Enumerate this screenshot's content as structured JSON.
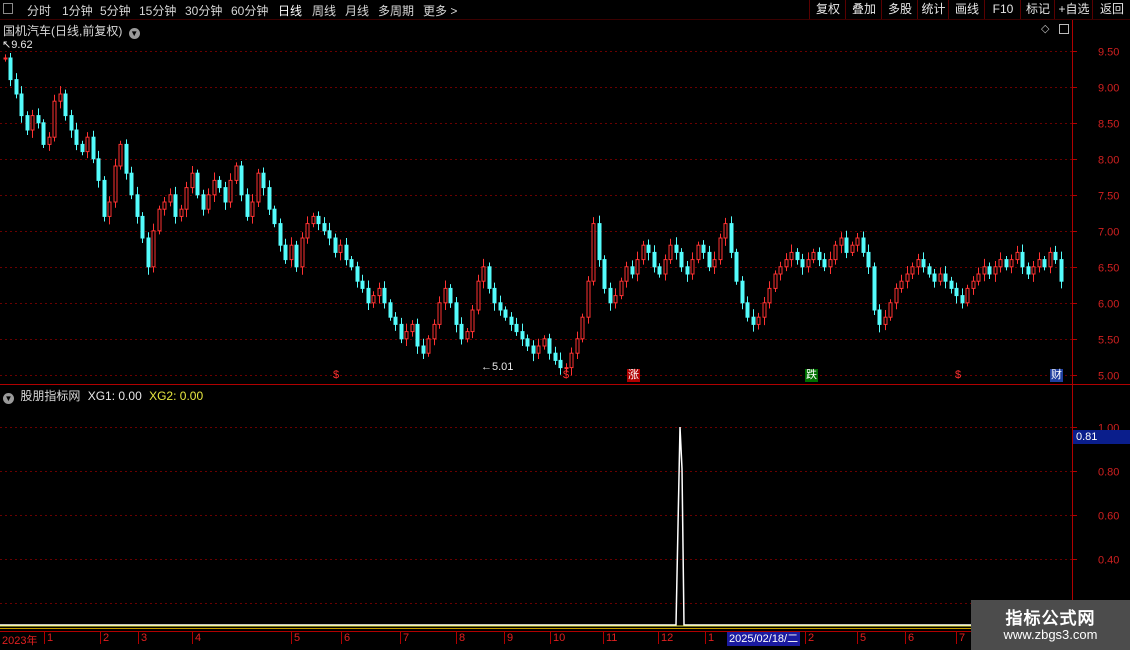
{
  "toolbar": {
    "periods": [
      "分时",
      "1分钟",
      "5分钟",
      "15分钟",
      "30分钟",
      "60分钟",
      "日线",
      "周线",
      "月线",
      "多周期",
      "更多 >"
    ],
    "active_period": "日线",
    "buttons": [
      "复权",
      "叠加",
      "多股",
      "统计",
      "画线",
      "F10",
      "标记",
      "+自选",
      "返回"
    ]
  },
  "main_chart": {
    "stock_title": "国机汽车(日线,前复权)",
    "high_label": "9.62",
    "low_label": "5.01",
    "markers": [
      {
        "text": "$",
        "color": "#ff3030"
      },
      {
        "text": "$",
        "color": "#ff3030"
      },
      {
        "text": "涨",
        "color": "#ffffff",
        "bg": "#b00000"
      },
      {
        "text": "跌",
        "color": "#ffffff",
        "bg": "#007000"
      },
      {
        "text": "$",
        "color": "#ff3030"
      },
      {
        "text": "财",
        "color": "#ffffff",
        "bg": "#2040a0"
      }
    ]
  },
  "indicator": {
    "name": "股朋指标网",
    "xg1": "XG1: 0.00",
    "xg2": "XG2: 0.00",
    "current_value": "0.81"
  },
  "time_axis": {
    "year_label": "2023年",
    "months": [
      "1",
      "2",
      "3",
      "4",
      "5",
      "6",
      "7",
      "8",
      "9",
      "10",
      "11",
      "12",
      "1",
      "2",
      "4",
      "5",
      "6",
      "7"
    ],
    "cursor_date": "2025/02/18/二"
  },
  "watermark": {
    "title": "指标公式网",
    "url": "www.zbgs3.com"
  },
  "chart_data": [
    {
      "type": "candlestick",
      "title": "国机汽车(日线,前复权)",
      "ylim": [
        4.9,
        9.9
      ],
      "y_ticks": [
        5.0,
        5.5,
        6.0,
        6.5,
        7.0,
        7.5,
        8.0,
        8.5,
        9.0,
        9.5
      ],
      "annotations": [
        {
          "label": "9.62",
          "kind": "high"
        },
        {
          "label": "5.01",
          "kind": "low"
        }
      ],
      "close_series": [
        9.4,
        9.1,
        8.9,
        8.6,
        8.4,
        8.6,
        8.5,
        8.2,
        8.3,
        8.8,
        8.9,
        8.6,
        8.4,
        8.2,
        8.1,
        8.3,
        8.0,
        7.7,
        7.2,
        7.4,
        7.9,
        8.2,
        7.8,
        7.5,
        7.2,
        6.9,
        6.5,
        7.0,
        7.3,
        7.4,
        7.5,
        7.2,
        7.3,
        7.6,
        7.8,
        7.5,
        7.3,
        7.5,
        7.7,
        7.6,
        7.4,
        7.7,
        7.9,
        7.5,
        7.2,
        7.4,
        7.8,
        7.6,
        7.3,
        7.1,
        6.8,
        6.6,
        6.8,
        6.5,
        6.9,
        7.1,
        7.2,
        7.1,
        7.0,
        6.9,
        6.7,
        6.8,
        6.6,
        6.5,
        6.3,
        6.2,
        6.0,
        6.1,
        6.2,
        6.0,
        5.8,
        5.7,
        5.5,
        5.6,
        5.7,
        5.4,
        5.3,
        5.5,
        5.7,
        6.0,
        6.2,
        6.0,
        5.7,
        5.5,
        5.6,
        5.9,
        6.3,
        6.5,
        6.2,
        6.0,
        5.9,
        5.8,
        5.7,
        5.6,
        5.5,
        5.4,
        5.3,
        5.4,
        5.5,
        5.3,
        5.2,
        5.1,
        5.1,
        5.3,
        5.5,
        5.8,
        6.3,
        7.1,
        6.6,
        6.2,
        6.0,
        6.1,
        6.3,
        6.5,
        6.4,
        6.6,
        6.8,
        6.7,
        6.5,
        6.4,
        6.6,
        6.8,
        6.7,
        6.5,
        6.4,
        6.6,
        6.8,
        6.7,
        6.5,
        6.6,
        6.9,
        7.1,
        6.7,
        6.3,
        6.0,
        5.8,
        5.7,
        5.8,
        6.0,
        6.2,
        6.4,
        6.5,
        6.6,
        6.7,
        6.6,
        6.5,
        6.6,
        6.7,
        6.6,
        6.5,
        6.6,
        6.8,
        6.9,
        6.7,
        6.8,
        6.9,
        6.7,
        6.5,
        5.9,
        5.7,
        5.8,
        6.0,
        6.2,
        6.3,
        6.4,
        6.5,
        6.6,
        6.5,
        6.4,
        6.3,
        6.4,
        6.3,
        6.2,
        6.1,
        6.0,
        6.2,
        6.3,
        6.4,
        6.5,
        6.4,
        6.5,
        6.6,
        6.5,
        6.6,
        6.7,
        6.5,
        6.4,
        6.5,
        6.6,
        6.5,
        6.7,
        6.6,
        6.3
      ]
    },
    {
      "type": "line",
      "title": "股朋指标网",
      "ylim": [
        0.1,
        1.1
      ],
      "y_ticks": [
        0.2,
        0.4,
        0.6,
        0.8,
        1.0
      ],
      "series": [
        {
          "name": "XG1",
          "values": [
            0,
            1,
            0.81,
            0
          ]
        },
        {
          "name": "XG2",
          "values": [
            0,
            0,
            0,
            0
          ]
        }
      ]
    }
  ]
}
